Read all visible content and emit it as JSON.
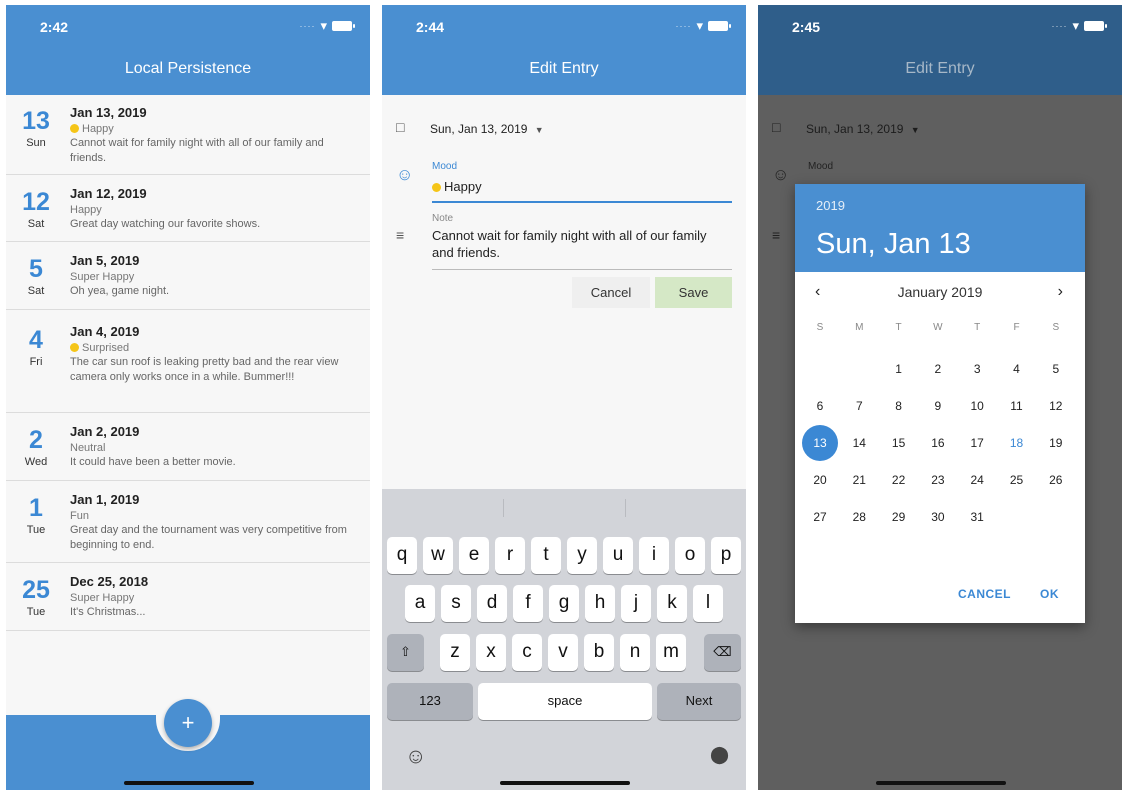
{
  "colors": {
    "primary": "#4a8fd1",
    "accent": "#3b88d4",
    "save_bg": "#d5e8c6"
  },
  "screen1": {
    "time": "2:42",
    "title": "Local Persistence",
    "entries": [
      {
        "day": "13",
        "weekday": "Sun",
        "date": "Jan 13, 2019",
        "mood": "Happy",
        "note": "Cannot wait for family night with all of our family and friends."
      },
      {
        "day": "12",
        "weekday": "Sat",
        "date": "Jan 12, 2019",
        "mood": "Happy",
        "note": "Great day watching our favorite shows."
      },
      {
        "day": "5",
        "weekday": "Sat",
        "date": "Jan 5, 2019",
        "mood": "Super Happy",
        "note": "Oh yea, game night."
      },
      {
        "day": "4",
        "weekday": "Fri",
        "date": "Jan 4, 2019",
        "mood": "Surprised",
        "note": "The car sun roof is leaking pretty bad and the rear view camera only works once in a while. Bummer!!!"
      },
      {
        "day": "2",
        "weekday": "Wed",
        "date": "Jan 2, 2019",
        "mood": "Neutral",
        "note": "It could have been a better movie."
      },
      {
        "day": "1",
        "weekday": "Tue",
        "date": "Jan 1, 2019",
        "mood": "Fun",
        "note": "Great day and the tournament was very competitive from beginning to end."
      },
      {
        "day": "25",
        "weekday": "Tue",
        "date": "Dec 25, 2018",
        "mood": "Super Happy",
        "note": "It's Christmas..."
      }
    ],
    "fab": "+"
  },
  "screen2": {
    "time": "2:44",
    "title": "Edit Entry",
    "date_value": "Sun, Jan 13, 2019",
    "mood_label": "Mood",
    "mood_value": "Happy",
    "note_label": "Note",
    "note_value": "Cannot wait for family night with all of our family and friends.",
    "cancel": "Cancel",
    "save": "Save",
    "keys_row1": [
      "q",
      "w",
      "e",
      "r",
      "t",
      "y",
      "u",
      "i",
      "o",
      "p"
    ],
    "keys_row2": [
      "a",
      "s",
      "d",
      "f",
      "g",
      "h",
      "j",
      "k",
      "l"
    ],
    "keys_row3": [
      "z",
      "x",
      "c",
      "v",
      "b",
      "n",
      "m"
    ],
    "key_123": "123",
    "key_space": "space",
    "key_next": "Next"
  },
  "screen3": {
    "time": "2:45",
    "title": "Edit Entry",
    "date_value": "Sun, Jan 13, 2019",
    "mood_label": "Mood",
    "year": "2019",
    "selected_date": "Sun, Jan 13",
    "month": "January 2019",
    "weekdays": [
      "S",
      "M",
      "T",
      "W",
      "T",
      "F",
      "S"
    ],
    "first_weekday_index": 2,
    "days_in_month": 31,
    "selected_day": 13,
    "today_day": 18,
    "cancel": "CANCEL",
    "ok": "OK"
  }
}
